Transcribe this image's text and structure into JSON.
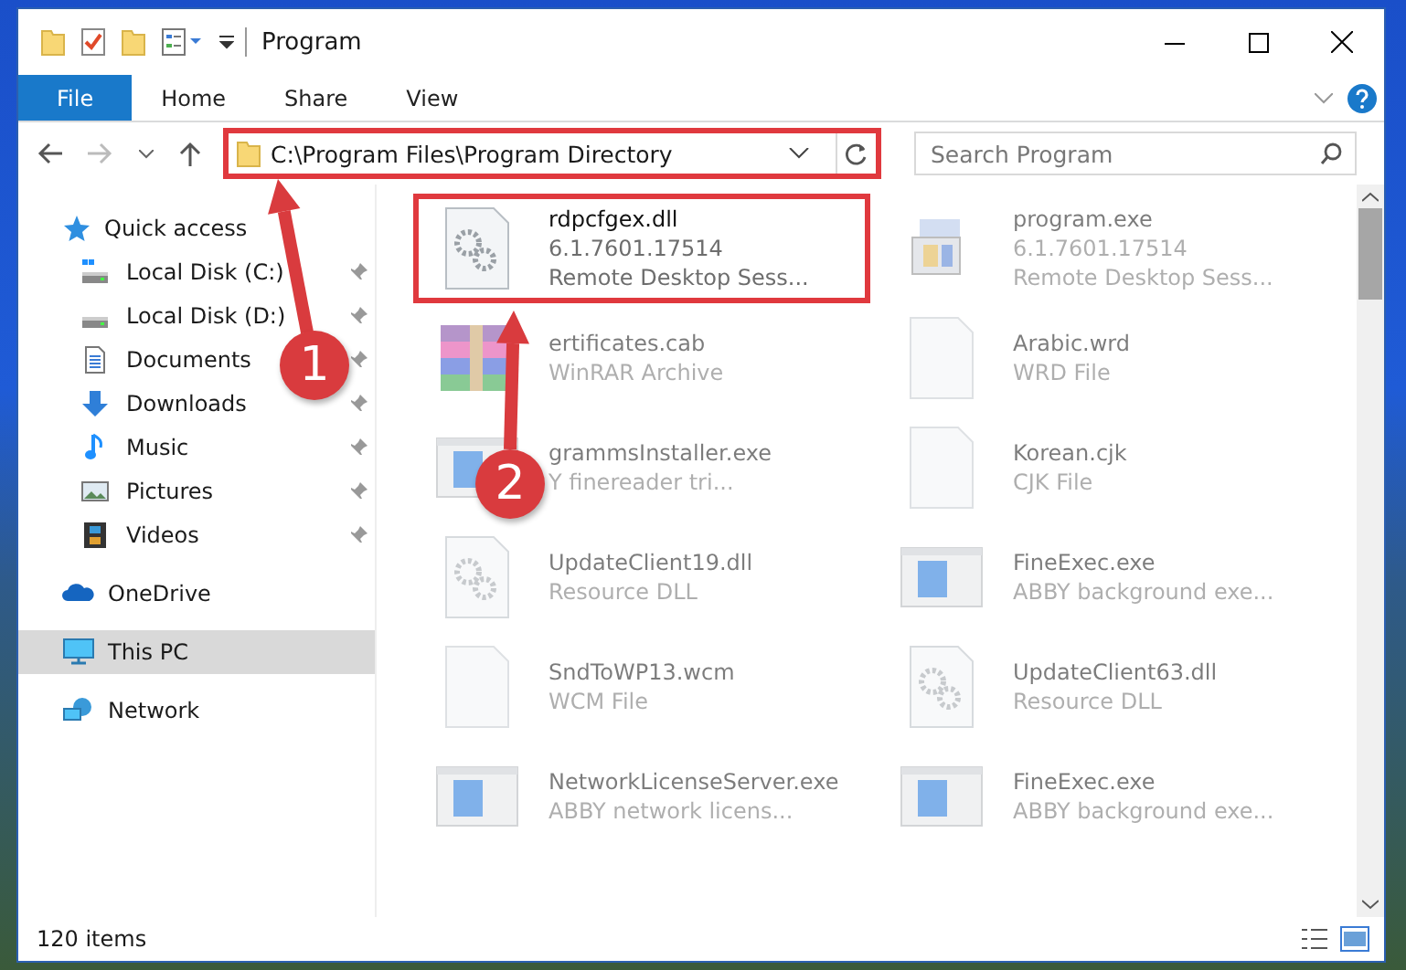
{
  "window": {
    "title": "Program"
  },
  "ribbon": {
    "tabs": [
      {
        "label": "File",
        "selected": true
      },
      {
        "label": "Home",
        "selected": false
      },
      {
        "label": "Share",
        "selected": false
      },
      {
        "label": "View",
        "selected": false
      }
    ]
  },
  "address_bar": {
    "path": "C:\\Program Files\\Program Directory",
    "highlighted": true,
    "search_placeholder": "Search Program"
  },
  "sidebar": {
    "items": [
      {
        "label": "Quick access",
        "selected": false,
        "children": [
          {
            "label": "Local Disk (C:)",
            "pinned": true,
            "selected": false
          },
          {
            "label": "Local Disk (D:)",
            "pinned": true,
            "selected": false
          },
          {
            "label": "Documents",
            "pinned": true,
            "selected": false
          },
          {
            "label": "Downloads",
            "pinned": true,
            "selected": false
          },
          {
            "label": "Music",
            "pinned": true,
            "selected": false
          },
          {
            "label": "Pictures",
            "pinned": true,
            "selected": false
          },
          {
            "label": "Videos",
            "pinned": true,
            "selected": false
          }
        ]
      },
      {
        "label": "OneDrive",
        "selected": false
      },
      {
        "label": "This PC",
        "selected": true
      },
      {
        "label": "Network",
        "selected": false
      }
    ]
  },
  "files": [
    {
      "name": "rdpcfgex.dll",
      "details": [
        "6.1.7601.17514",
        "Remote Desktop Sess..."
      ],
      "kind": "gear",
      "highlighted": true
    },
    {
      "name": "program.exe",
      "details": [
        "6.1.7601.17514",
        "Remote Desktop Sess..."
      ],
      "kind": "installer",
      "highlighted": false
    },
    {
      "name": "ertificates.cab",
      "details": [
        "WinRAR Archive"
      ],
      "kind": "archive",
      "highlighted": false
    },
    {
      "name": "Arabic.wrd",
      "details": [
        "WRD File"
      ],
      "kind": "blank",
      "highlighted": false
    },
    {
      "name": "grammsInstaller.exe",
      "details": [
        "Y finereader tri..."
      ],
      "kind": "app",
      "highlighted": false
    },
    {
      "name": "Korean.cjk",
      "details": [
        "CJK File"
      ],
      "kind": "blank",
      "highlighted": false
    },
    {
      "name": "UpdateClient19.dll",
      "details": [
        "Resource DLL"
      ],
      "kind": "gear",
      "highlighted": false
    },
    {
      "name": "FineExec.exe",
      "details": [
        "ABBY background exe..."
      ],
      "kind": "app",
      "highlighted": false
    },
    {
      "name": "SndToWP13.wcm",
      "details": [
        "WCM File"
      ],
      "kind": "blank",
      "highlighted": false
    },
    {
      "name": "UpdateClient63.dll",
      "details": [
        "Resource DLL"
      ],
      "kind": "gear",
      "highlighted": false
    },
    {
      "name": "NetworkLicenseServer.exe",
      "details": [
        "ABBY network licens..."
      ],
      "kind": "app",
      "highlighted": false
    },
    {
      "name": "FineExec.exe",
      "details": [
        "ABBY background exe..."
      ],
      "kind": "app",
      "highlighted": false
    }
  ],
  "status_bar": {
    "count": "120 items"
  },
  "callouts": [
    {
      "number": "1"
    },
    {
      "number": "2"
    }
  ]
}
